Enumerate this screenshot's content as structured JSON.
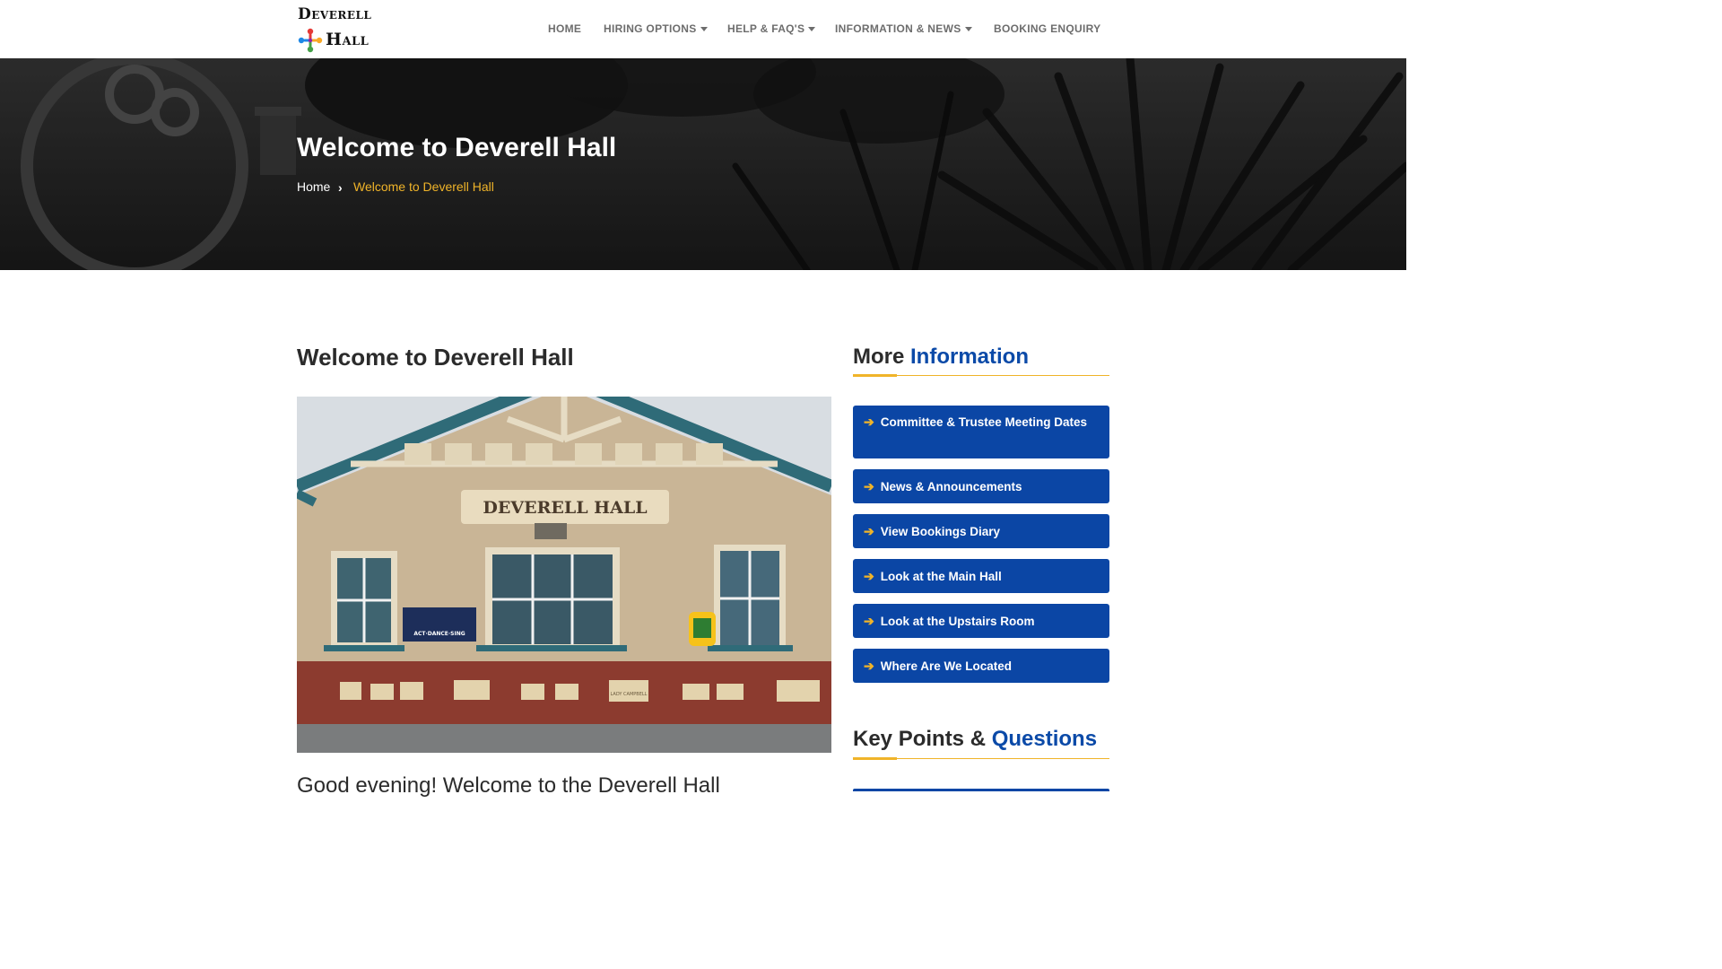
{
  "site": {
    "logo_line1": "Deverell",
    "logo_line2": "Hall"
  },
  "nav": {
    "home": "HOME",
    "hiring_options": "HIRING OPTIONS",
    "help_faqs": "HELP & FAQ'S",
    "info_news": "INFORMATION & NEWS",
    "booking_enquiry": "BOOKING ENQUIRY"
  },
  "hero": {
    "title": "Welcome to Deverell Hall",
    "breadcrumb_home": "Home",
    "breadcrumb_current": "Welcome to Deverell Hall"
  },
  "main": {
    "heading": "Welcome to Deverell Hall",
    "photo_sign": "DEVERELL HALL",
    "photo_poster": "ACT·DANCE·SING",
    "photo_stone": "LADY CAMPBELL",
    "greeting": "Good evening! Welcome to the Deverell Hall"
  },
  "sidebar": {
    "more_info_title_plain": "More",
    "more_info_title_accent": "Information",
    "links": [
      "Committee & Trustee Meeting Dates",
      "News & Announcements",
      "View Bookings Diary",
      "Look at the Main Hall",
      "Look at the Upstairs Room",
      "Where Are We Located"
    ],
    "key_points_title_plain": "Key Points &",
    "key_points_title_accent": "Questions"
  },
  "colors": {
    "accent_blue": "#0b46a5",
    "accent_yellow": "#f0b429",
    "nav_grey": "#6d6d6d"
  }
}
